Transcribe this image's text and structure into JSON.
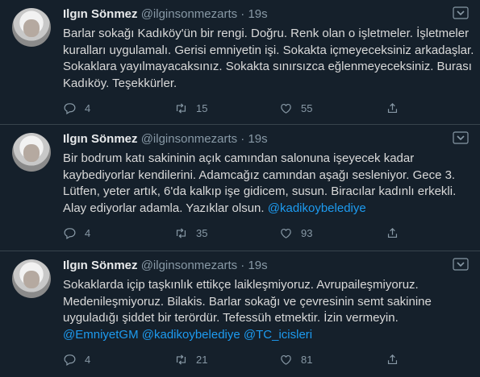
{
  "tweets": [
    {
      "name": "Ilgın Sönmez",
      "handle": "@ilginsonmezarts",
      "time": "19s",
      "lines": [
        "Barlar sokağı Kadıköy'ün bir rengi. Doğru. Renk olan o işletmeler. İşletmeler",
        "kuralları uygulamalı. Gerisi emniyetin işi. Sokakta içmeyeceksiniz arkadaşlar.",
        "Sokaklara yayılmayacaksınız. Sokakta sınırsızca eğlenmeyeceksiniz. Burası",
        "Kadıköy. Teşekkürler."
      ],
      "replies": "4",
      "retweets": "15",
      "likes": "55"
    },
    {
      "name": "Ilgın Sönmez",
      "handle": "@ilginsonmezarts",
      "time": "19s",
      "lines": [
        "Bir bodrum katı sakininin açık camından salonuna işeyecek kadar",
        "kaybediyorlar kendilerini. Adamcağız camından aşağı sesleniyor. Gece 3.",
        "Lütfen, yeter artık, 6'da kalkıp işe gidicem, susun. Biracılar kadınlı erkekli.",
        "Alay ediyorlar adamla. Yazıklar olsun."
      ],
      "mention": "@kadikoybelediye",
      "replies": "4",
      "retweets": "35",
      "likes": "93"
    },
    {
      "name": "Ilgın Sönmez",
      "handle": "@ilginsonmezarts",
      "time": "19s",
      "lines": [
        "Sokaklarda içip taşkınlık ettikçe laikleşmiyoruz. Avrupaileşmiyoruz.",
        "Medenileşmiyoruz. Bilakis. Barlar sokağı ve çevresinin semt sakinine",
        "uyguladığı şiddet bir terördür. Tefessüh etmektir. İzin vermeyin."
      ],
      "mentions": [
        "@EmniyetGM",
        "@kadikoybelediye",
        "@TC_icisleri"
      ],
      "replies": "4",
      "retweets": "21",
      "likes": "81"
    }
  ],
  "separator": "·",
  "icons": [
    "avatar",
    "chevron-down-icon",
    "reply-icon",
    "retweet-icon",
    "like-icon",
    "share-icon"
  ],
  "colors": {
    "background": "#15202b",
    "mention": "#1d9bf0",
    "muted": "#8899a6",
    "divider": "#38444d"
  }
}
